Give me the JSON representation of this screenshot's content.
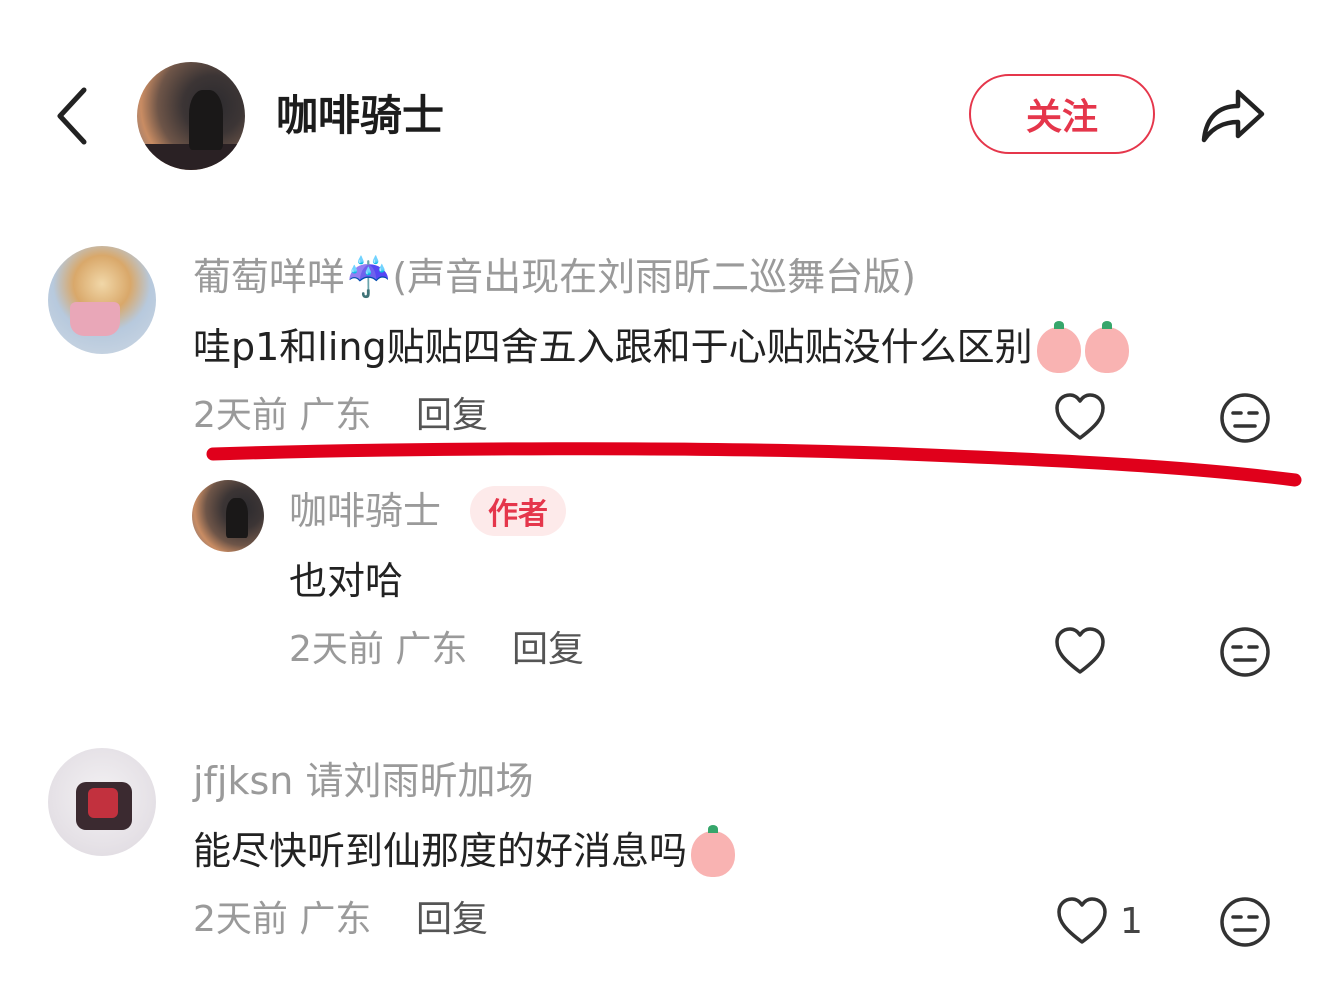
{
  "header": {
    "title": "咖啡骑士",
    "follow_label": "关注"
  },
  "comments": [
    {
      "username": "葡萄咩咩☔️(声音出现在刘雨昕二巡舞台版)",
      "text": "哇p1和ling贴贴四舍五入跟和于心贴贴没什么区别",
      "emojis": [
        "drooling-heart-eyes-emoji",
        "drooling-heart-eyes-emoji"
      ],
      "time": "2天前",
      "location": "广东",
      "reply_label": "回复",
      "likes": ""
    },
    {
      "username": "咖啡骑士",
      "badge": "作者",
      "text": "也对哈",
      "time": "2天前",
      "location": "广东",
      "reply_label": "回复",
      "likes": ""
    },
    {
      "username": "jfjksn 请刘雨昕加场",
      "text": "能尽快听到仙那度的好消息吗",
      "emojis": [
        "surprised-face-emoji"
      ],
      "time": "2天前",
      "location": "广东",
      "reply_label": "回复",
      "likes": "1"
    }
  ],
  "icons": {
    "back": "back-chevron-icon",
    "share": "share-arrow-icon",
    "like": "heart-icon",
    "dislike": "meh-face-icon"
  },
  "colors": {
    "accent": "#e5364b",
    "annotation": "#e0001b",
    "muted_text": "#9a9a9a"
  }
}
